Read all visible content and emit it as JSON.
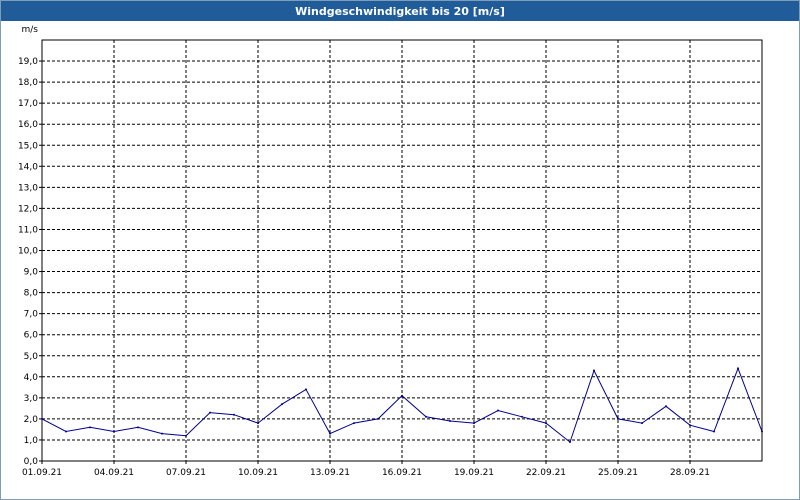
{
  "window": {
    "title": "Windgeschwindigkeit bis 20 [m/s]"
  },
  "chart_data": {
    "type": "line",
    "title": "Windgeschwindigkeit bis 20 [m/s]",
    "y_unit": "m/s",
    "ylim": [
      0,
      20
    ],
    "xlim": [
      "01.09.21",
      "01.10.21"
    ],
    "y_ticks": [
      "0,0",
      "1,0",
      "2,0",
      "3,0",
      "4,0",
      "5,0",
      "6,0",
      "7,0",
      "8,0",
      "9,0",
      "10,0",
      "11,0",
      "12,0",
      "13,0",
      "14,0",
      "15,0",
      "16,0",
      "17,0",
      "18,0",
      "19,0"
    ],
    "x_ticks": [
      "01.09.21",
      "04.09.21",
      "07.09.21",
      "10.09.21",
      "13.09.21",
      "16.09.21",
      "19.09.21",
      "22.09.21",
      "25.09.21",
      "28.09.21"
    ],
    "grid": true,
    "line_color": "#00008b",
    "series": [
      {
        "x": [
          "01.09.21",
          "02.09.21",
          "03.09.21",
          "04.09.21",
          "05.09.21",
          "06.09.21",
          "07.09.21",
          "08.09.21",
          "09.09.21",
          "10.09.21",
          "11.09.21",
          "12.09.21",
          "13.09.21",
          "14.09.21",
          "15.09.21",
          "16.09.21",
          "17.09.21",
          "18.09.21",
          "19.09.21",
          "20.09.21",
          "21.09.21",
          "22.09.21",
          "23.09.21",
          "24.09.21",
          "25.09.21",
          "26.09.21",
          "27.09.21",
          "28.09.21",
          "29.09.21",
          "30.09.21",
          "01.10.21"
        ],
        "values": [
          2.0,
          1.4,
          1.6,
          1.4,
          1.6,
          1.3,
          1.2,
          2.3,
          2.2,
          1.8,
          2.7,
          3.4,
          1.3,
          1.8,
          2.0,
          3.1,
          2.1,
          1.9,
          1.8,
          2.4,
          2.1,
          1.8,
          0.9,
          4.3,
          2.0,
          1.8,
          2.6,
          1.7,
          1.4,
          4.4,
          1.4
        ]
      }
    ]
  }
}
